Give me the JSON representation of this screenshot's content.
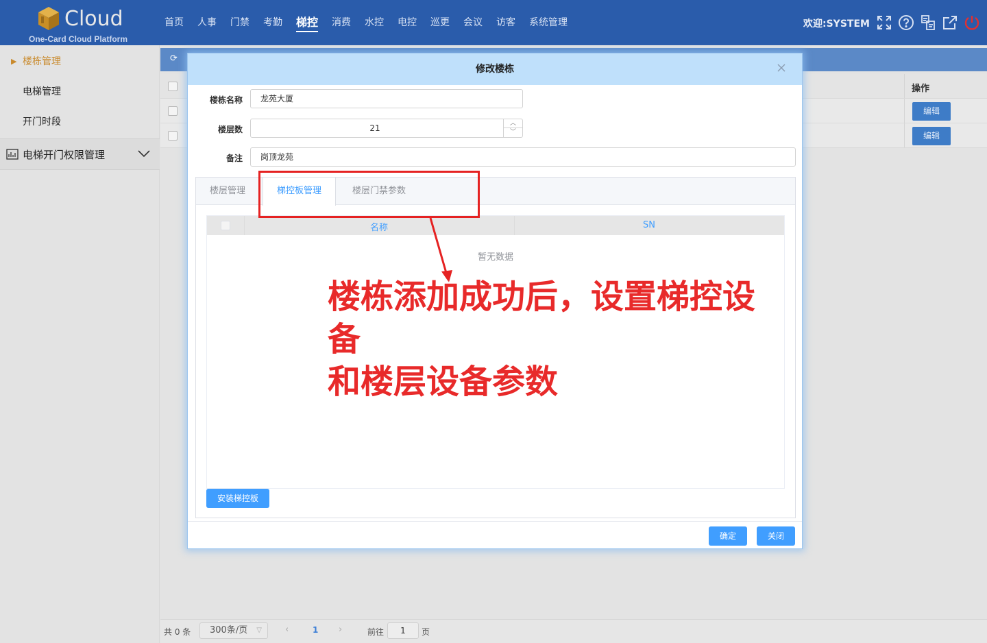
{
  "header": {
    "logo_text": "Cloud",
    "logo_sub": "One-Card Cloud Platform",
    "nav": [
      "首页",
      "人事",
      "门禁",
      "考勤",
      "梯控",
      "消费",
      "水控",
      "电控",
      "巡更",
      "会议",
      "访客",
      "系统管理"
    ],
    "active_nav": "梯控",
    "welcome": "欢迎:SYSTEM",
    "icons": [
      "fullscreen-icon",
      "help-icon",
      "switch-icon",
      "external-link-icon",
      "power-icon"
    ]
  },
  "sidebar": {
    "items": [
      {
        "label": "楼栋管理",
        "active": true
      },
      {
        "label": "电梯管理",
        "active": false
      },
      {
        "label": "开门时段",
        "active": false
      }
    ],
    "group": {
      "label": "电梯开门权限管理"
    }
  },
  "background_table": {
    "op_header": "操作",
    "edit_label": "编辑",
    "rows": 2
  },
  "pager": {
    "total": "共 0 条",
    "page_size": "300条/页",
    "current_page": "1",
    "goto_label": "前往",
    "goto_value": "1",
    "page_unit": "页"
  },
  "dialog": {
    "title": "修改楼栋",
    "fields": {
      "name_label": "楼栋名称",
      "name_value": "龙苑大厦",
      "floors_label": "楼层数",
      "floors_value": "21",
      "remark_label": "备注",
      "remark_value": "岗顶龙苑"
    },
    "tabs": [
      "楼层管理",
      "梯控板管理",
      "楼层门禁参数"
    ],
    "active_tab": "梯控板管理",
    "table": {
      "col_name": "名称",
      "col_sn": "SN",
      "empty_text": "暂无数据"
    },
    "install_button": "安装梯控板",
    "ok_button": "确定",
    "close_button": "关闭"
  },
  "annotation": {
    "line1": "楼栋添加成功后，设置梯控设备",
    "line2": "和楼层设备参数",
    "color": "#e82a2a"
  },
  "colors": {
    "header_bg": "#2a5cab",
    "primary": "#409eff",
    "dialog_title_bg": "#bfe0fb",
    "sidebar_active": "#c98a2c"
  }
}
